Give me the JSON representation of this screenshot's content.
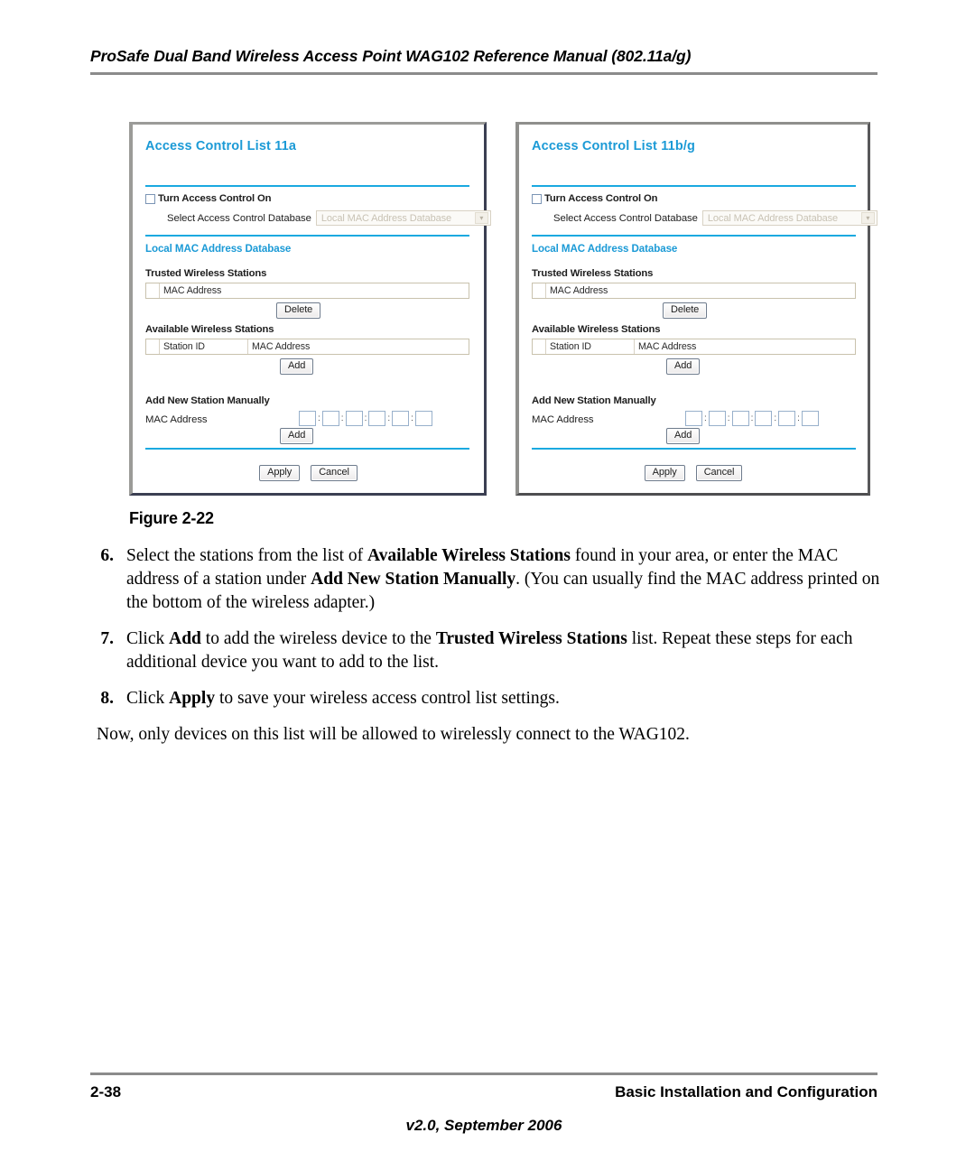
{
  "header": {
    "title": "ProSafe Dual Band Wireless Access Point WAG102 Reference Manual (802.11a/g)"
  },
  "figure": {
    "caption": "Figure 2-22",
    "panels": [
      {
        "id": "acl-11a",
        "title": "Access Control List 11a",
        "turn_on_label": "Turn Access Control On",
        "select_db_label": "Select Access Control Database",
        "select_db_value": "Local MAC Address Database",
        "select_arrow_icon": "chevron-down-icon",
        "section_local_db": "Local MAC Address Database",
        "trusted_label": "Trusted Wireless Stations",
        "trusted_columns": [
          "MAC Address"
        ],
        "delete_button": "Delete",
        "available_label": "Available Wireless Stations",
        "available_columns": [
          "Station ID",
          "MAC Address"
        ],
        "add_list_button": "Add",
        "add_new_label": "Add New Station Manually",
        "mac_address_label": "MAC Address",
        "mac_octets": [
          "",
          "",
          "",
          "",
          "",
          ""
        ],
        "mac_separator": ":",
        "add_manual_button": "Add",
        "apply_button": "Apply",
        "cancel_button": "Cancel"
      },
      {
        "id": "acl-11bg",
        "title": "Access Control List 11b/g",
        "turn_on_label": "Turn Access Control On",
        "select_db_label": "Select Access Control Database",
        "select_db_value": "Local MAC Address Database",
        "select_arrow_icon": "chevron-down-icon",
        "section_local_db": "Local MAC Address Database",
        "trusted_label": "Trusted Wireless Stations",
        "trusted_columns": [
          "MAC Address"
        ],
        "delete_button": "Delete",
        "available_label": "Available Wireless Stations",
        "available_columns": [
          "Station ID",
          "MAC Address"
        ],
        "add_list_button": "Add",
        "add_new_label": "Add New Station Manually",
        "mac_address_label": "MAC Address",
        "mac_octets": [
          "",
          "",
          "",
          "",
          "",
          ""
        ],
        "mac_separator": ":",
        "add_manual_button": "Add",
        "apply_button": "Apply",
        "cancel_button": "Cancel"
      }
    ]
  },
  "body": {
    "steps": [
      {
        "number": "6.",
        "parts": [
          {
            "text": "Select the stations from the list of ",
            "bold": false
          },
          {
            "text": "Available Wireless Stations",
            "bold": true
          },
          {
            "text": " found in your area, or enter the MAC address of a station under ",
            "bold": false
          },
          {
            "text": "Add New Station Manually",
            "bold": true
          },
          {
            "text": ". (You can usually find the MAC address printed on the bottom of the wireless adapter.)",
            "bold": false
          }
        ]
      },
      {
        "number": "7.",
        "parts": [
          {
            "text": "Click ",
            "bold": false
          },
          {
            "text": "Add",
            "bold": true
          },
          {
            "text": " to add the wireless device to the ",
            "bold": false
          },
          {
            "text": "Trusted Wireless Stations",
            "bold": true
          },
          {
            "text": " list. Repeat these steps for each additional device you want to add to the list.",
            "bold": false
          }
        ]
      },
      {
        "number": "8.",
        "parts": [
          {
            "text": "Click ",
            "bold": false
          },
          {
            "text": "Apply",
            "bold": true
          },
          {
            "text": " to save your wireless access control list settings.",
            "bold": false
          }
        ]
      }
    ],
    "closing_paragraph": "Now, only devices on this list will be allowed to wirelessly connect to the WAG102."
  },
  "footer": {
    "page_number": "2-38",
    "chapter": "Basic Installation and Configuration",
    "version": "v2.0, September 2006"
  },
  "colors": {
    "accent_cyan": "#1aa9e0",
    "heading_blue": "#1b9ad6",
    "rule_gray": "#8b8b8b"
  }
}
